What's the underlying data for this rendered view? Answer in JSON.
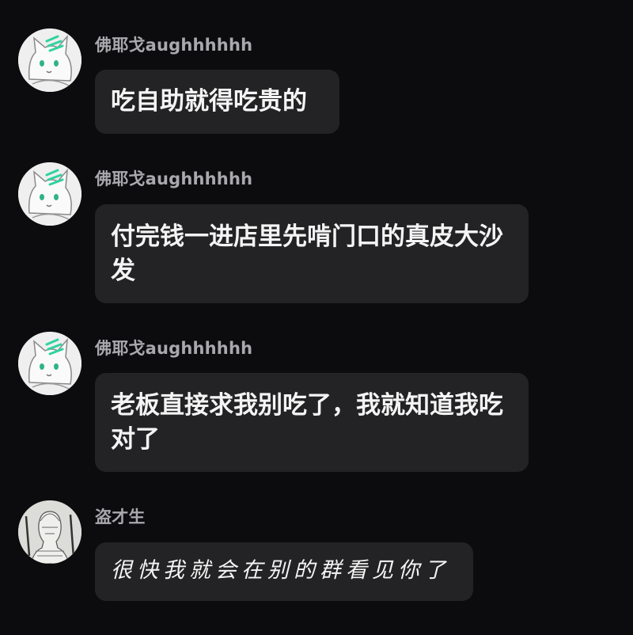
{
  "messages": [
    {
      "sender": "佛耶戈aughhhhhh",
      "avatar_icon": "white-cat-avatar-icon",
      "text": "吃自助就得吃贵的"
    },
    {
      "sender": "佛耶戈aughhhhhh",
      "avatar_icon": "white-cat-avatar-icon",
      "text": "付完钱一进店里先啃门口的真皮大沙发"
    },
    {
      "sender": "佛耶戈aughhhhhh",
      "avatar_icon": "white-cat-avatar-icon",
      "text": "老板直接求我别吃了，我就知道我吃对了"
    },
    {
      "sender": "盗才生",
      "avatar_icon": "sketch-portrait-avatar-icon",
      "text": "很快我就会在别的群看见你了"
    }
  ],
  "colors": {
    "background": "#0c0c0e",
    "bubble": "#232325",
    "sender_name": "#a9a9ad",
    "message_text": "#f4f4f4",
    "avatar_accent": "#2fd3a0"
  }
}
